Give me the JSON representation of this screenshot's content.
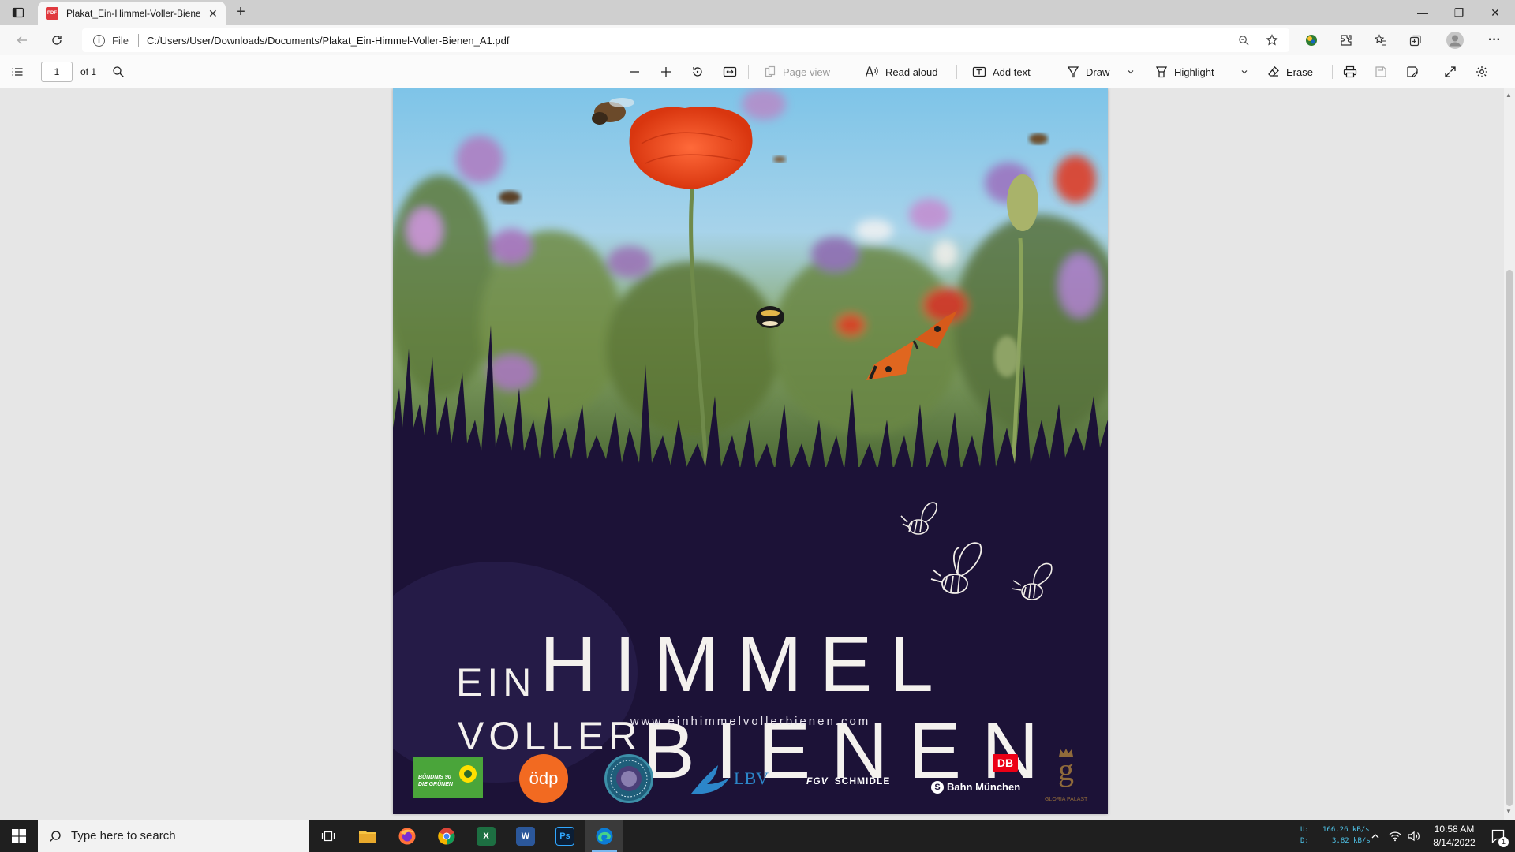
{
  "browser": {
    "tab": {
      "title": "Plakat_Ein-Himmel-Voller-Bienen_A1.pdf",
      "close_glyph": "✕",
      "icon_text": "PDF"
    },
    "new_tab_glyph": "+",
    "window_controls": {
      "minimize": "—",
      "restore": "❐",
      "close": "✕"
    },
    "address": {
      "scheme": "File",
      "url": "C:/Users/User/Downloads/Documents/Plakat_Ein-Himmel-Voller-Bienen_A1.pdf"
    },
    "menu_glyph": "···"
  },
  "pdf_toolbar": {
    "page_current": "1",
    "page_total": "of 1",
    "page_view": "Page view",
    "read_aloud": "Read aloud",
    "add_text": "Add text",
    "draw": "Draw",
    "highlight": "Highlight",
    "erase": "Erase"
  },
  "poster": {
    "line1_small": "EIN",
    "line1_big": "HIMMEL",
    "line2_small": "VOLLER",
    "line2_big": "BIENEN",
    "website": "www.einhimmelvollerbienen.com",
    "logos": {
      "gruene_line1": "BÜNDNIS 90",
      "gruene_line2": "DIE GRÜNEN",
      "odp": "ödp",
      "lbv": "LBV",
      "fgv": "FGV",
      "schmidle": "SCHMIDLE",
      "db": "DB",
      "sbahn_s": "S",
      "sbahn": "Bahn München",
      "gloria_g": "g",
      "gloria": "GLORIA PALAST"
    }
  },
  "taskbar": {
    "search_placeholder": "Type here to search",
    "apps": {
      "excel": "X",
      "word": "W",
      "photoshop": "Ps"
    },
    "net": {
      "up_label": "U:",
      "up_value": "166.26 kB/s",
      "down_label": "D:",
      "down_value": "3.82 kB/s"
    },
    "time": "10:58 AM",
    "date": "8/14/2022",
    "notification_count": "1"
  },
  "colors": {
    "accent": "#0078d4",
    "poster_dark": "#1c1237",
    "poppy": "#e8441e",
    "odp_orange": "#f26a21",
    "gruene_green": "#4aa53a",
    "db_red": "#ec0016"
  }
}
